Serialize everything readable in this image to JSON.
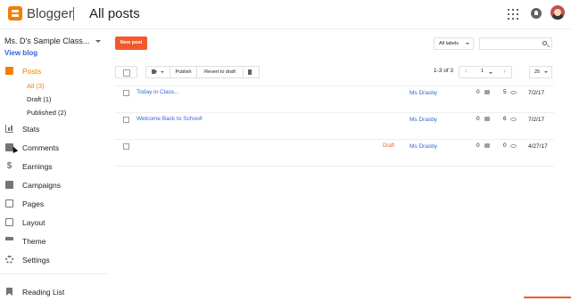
{
  "app": {
    "brand": "Blogger",
    "page_title": "All posts",
    "accent": "#f57d00",
    "button_color": "#f1592a",
    "link_color": "#3367d6"
  },
  "header": {
    "icons": [
      "apps-icon",
      "notifications-icon",
      "account-avatar"
    ]
  },
  "sidebar": {
    "blog_name": "Ms. D's Sample Class...",
    "view_blog": "View blog",
    "nav": [
      {
        "label": "Posts",
        "icon": "posts-icon",
        "active": true
      },
      {
        "label": "Stats",
        "icon": "stats-icon"
      },
      {
        "label": "Comments",
        "icon": "comments-icon"
      },
      {
        "label": "Earnings",
        "icon": "dollar-icon"
      },
      {
        "label": "Campaigns",
        "icon": "campaigns-icon"
      },
      {
        "label": "Pages",
        "icon": "pages-icon"
      },
      {
        "label": "Layout",
        "icon": "layout-icon"
      },
      {
        "label": "Theme",
        "icon": "theme-icon"
      },
      {
        "label": "Settings",
        "icon": "gear-icon"
      }
    ],
    "subitems": [
      {
        "label": "All (3)",
        "active": true
      },
      {
        "label": "Draft (1)"
      },
      {
        "label": "Published (2)"
      }
    ],
    "reading_list": "Reading List"
  },
  "main": {
    "new_post": "New post",
    "labels_select": "All labels",
    "search_placeholder": "",
    "toolbar": {
      "publish": "Publish",
      "revert": "Revert to draft"
    },
    "page_info": "1-3 of 3",
    "pager": {
      "page": "1",
      "prev": "‹",
      "next": "›"
    },
    "per_page": "25",
    "posts": [
      {
        "title": "Today in Class...",
        "status": "",
        "author": "Ms Drasby",
        "comments": "0",
        "views": "5",
        "date": "7/2/17"
      },
      {
        "title": "Welcome Back to School!",
        "status": "",
        "author": "Ms Drasby",
        "comments": "0",
        "views": "6",
        "date": "7/2/17"
      },
      {
        "title": "",
        "status": "Draft",
        "author": "Ms Drasby",
        "comments": "0",
        "views": "0",
        "date": "4/27/17"
      }
    ]
  }
}
